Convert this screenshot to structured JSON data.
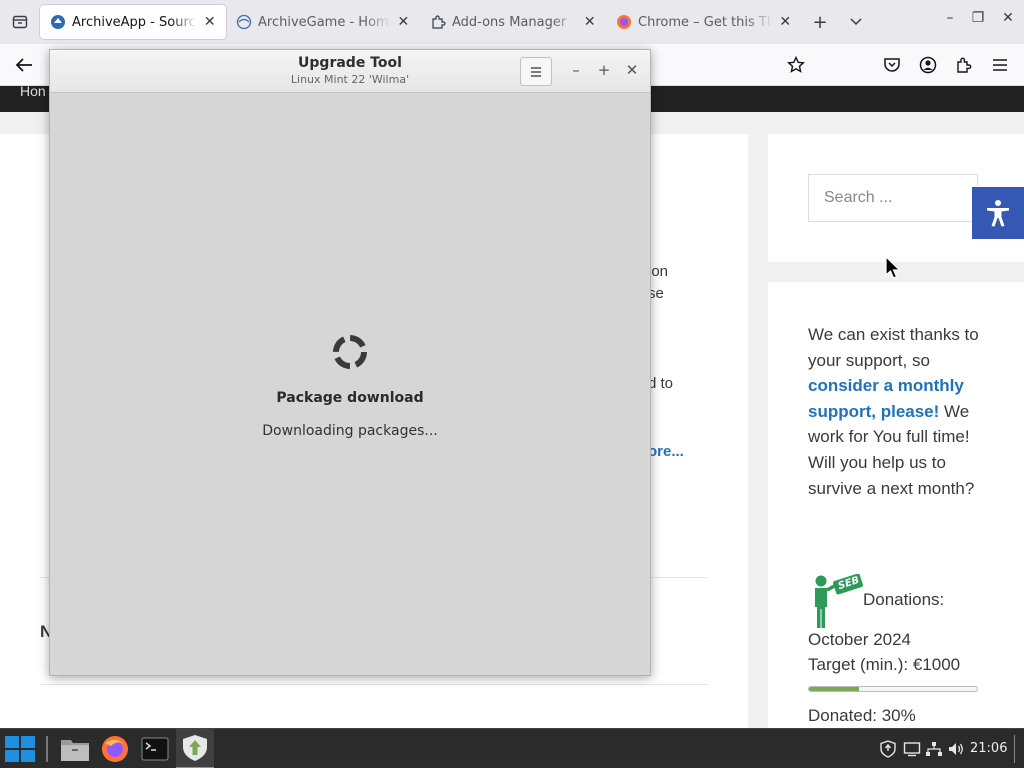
{
  "browser": {
    "tabs": [
      {
        "title": "ArchiveApp - Source of",
        "active": true,
        "favicon": "archiveapp-favicon"
      },
      {
        "title": "ArchiveGame - Home",
        "active": false,
        "favicon": "globe-favicon"
      },
      {
        "title": "Add-ons Manager",
        "active": false,
        "favicon": "puzzle-favicon"
      },
      {
        "title": "Chrome – Get this The",
        "active": false,
        "favicon": "firefox-favicon"
      }
    ]
  },
  "page": {
    "nav_fragment": "Hon",
    "fragments": [
      "ion",
      "se",
      "d to",
      "ore..."
    ],
    "bottom_fragment": "N",
    "search_placeholder": "Search ...",
    "support_lines": [
      {
        "text": "We can exist thanks to your support, so ",
        "highlight": false
      },
      {
        "text": "consider a monthly support, please!",
        "highlight": true
      },
      {
        "text": " We work for You full time! Will you help us to survive a next month?",
        "highlight": false
      }
    ],
    "donations": {
      "label": "Donations:",
      "period": "October 2024",
      "target": "Target (min.): €1000",
      "donated": "Donated: 30%",
      "progress_percent": 30,
      "badge_text": "SEB"
    }
  },
  "dialog": {
    "title": "Upgrade Tool",
    "subtitle": "Linux Mint 22 'Wilma'",
    "heading": "Package download",
    "status": "Downloading packages..."
  },
  "taskbar": {
    "clock": "21:06"
  },
  "colors": {
    "accent_blue": "#1e73be",
    "a11y_blue": "#3558b5",
    "progress_green": "#7fa75a",
    "taskbar_bg": "#2b2b2b"
  }
}
